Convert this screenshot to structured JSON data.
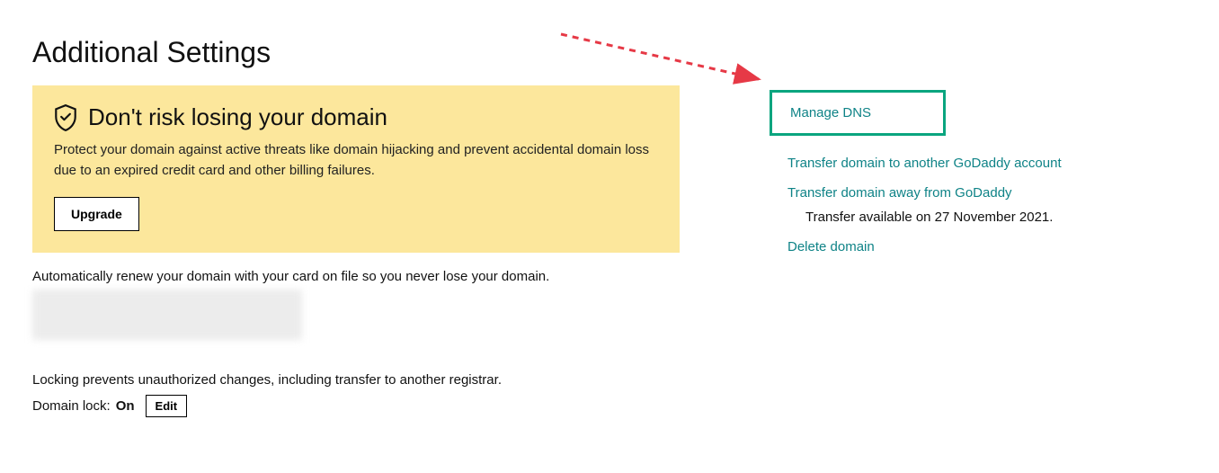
{
  "header": {
    "title": "Additional Settings"
  },
  "warning": {
    "title": "Don't risk losing your domain",
    "desc": "Protect your domain against active threats like domain hijacking and prevent accidental domain loss due to an expired credit card and other billing failures.",
    "button_label": "Upgrade"
  },
  "renew": {
    "text": "Automatically renew your domain with your card on file so you never lose your domain."
  },
  "lock": {
    "desc": "Locking prevents unauthorized changes, including transfer to another registrar.",
    "label": "Domain lock:",
    "status": "On",
    "edit_label": "Edit"
  },
  "links": {
    "manage_dns": "Manage DNS",
    "transfer_account": "Transfer domain to another GoDaddy account",
    "transfer_away": "Transfer domain away from GoDaddy",
    "transfer_note": "Transfer available on 27 November 2021.",
    "delete": "Delete domain"
  }
}
